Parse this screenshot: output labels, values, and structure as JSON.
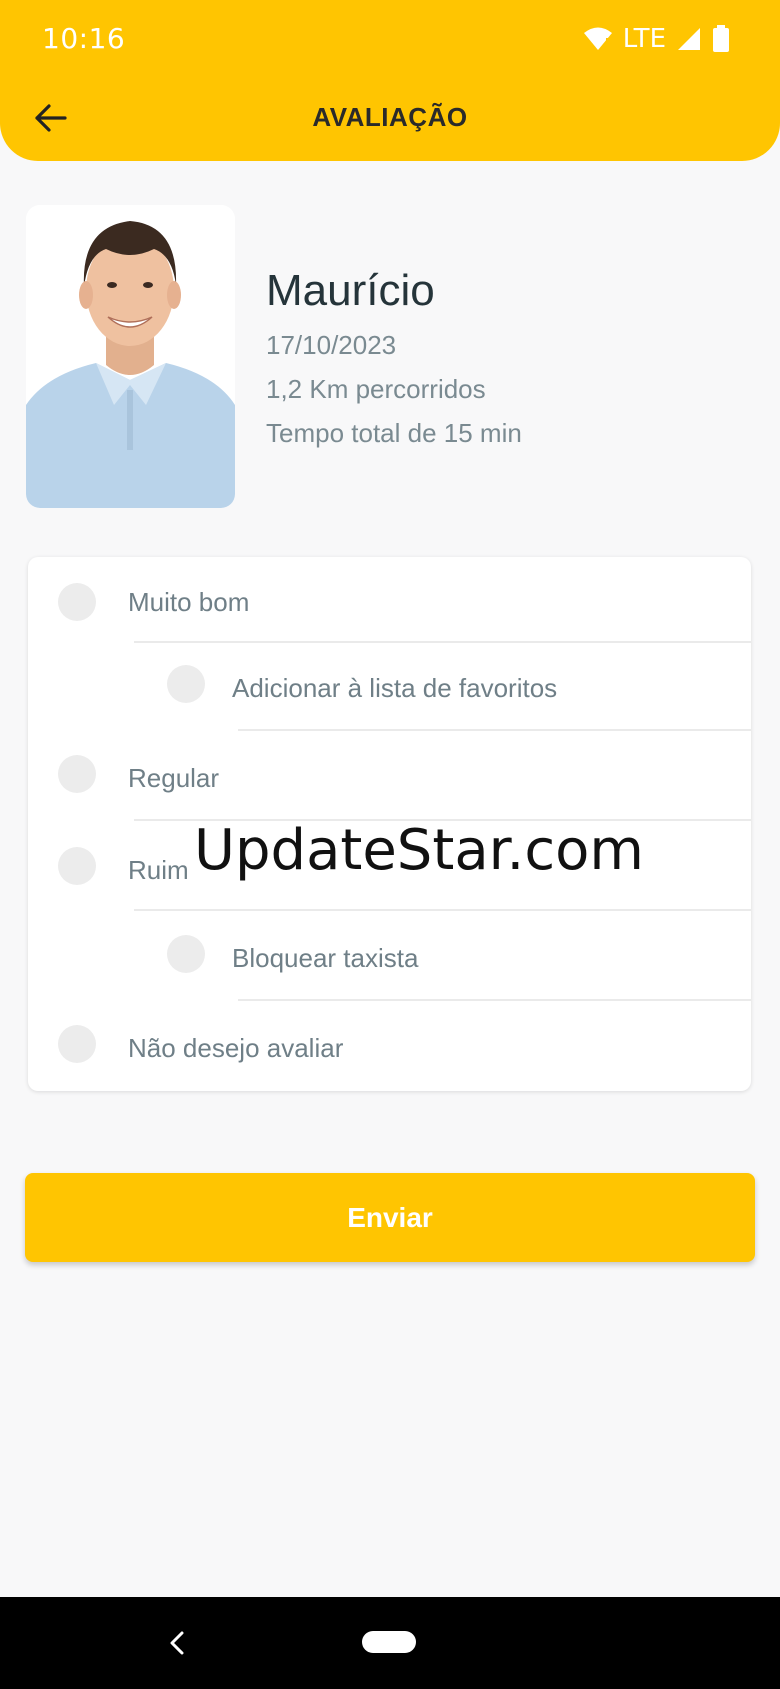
{
  "status_bar": {
    "time": "10:16",
    "network": "LTE"
  },
  "header": {
    "title": "AVALIAÇÃO",
    "background_color": "#ffc501"
  },
  "driver": {
    "name": "Maurício",
    "date": "17/10/2023",
    "distance": "1,2 Km percorridos",
    "duration": "Tempo total de 15 min"
  },
  "options": {
    "muito_bom": "Muito bom",
    "favoritos": "Adicionar à lista de favoritos",
    "regular": "Regular",
    "ruim": "Ruim",
    "bloquear": "Bloquear taxista",
    "nao_avaliar": "Não desejo avaliar"
  },
  "watermark": "UpdateStar.com",
  "submit": {
    "label": "Enviar"
  },
  "icons": {
    "back": "arrow-left-icon",
    "wifi": "wifi-icon",
    "signal": "signal-icon",
    "battery": "battery-icon"
  },
  "colors": {
    "accent": "#ffc501",
    "text_dark": "#25343a",
    "text_muted": "#7a8a91"
  }
}
